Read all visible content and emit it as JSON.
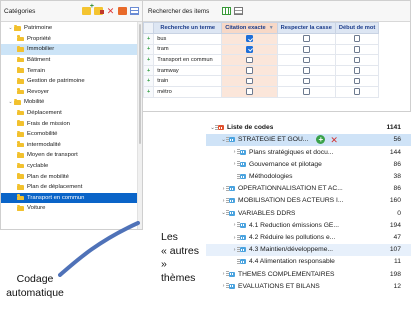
{
  "categories": {
    "title": "Catégories",
    "toolbar_icons": [
      "new-folder-icon",
      "edit-folder-icon",
      "delete-icon",
      "export-icon",
      "table-icon"
    ],
    "items": [
      {
        "label": "Patrimoine",
        "level": 0,
        "expanded": true
      },
      {
        "label": "Propriété",
        "level": 1
      },
      {
        "label": "Immobilier",
        "level": 1,
        "selected": true
      },
      {
        "label": "Bâtiment",
        "level": 1
      },
      {
        "label": "Terrain",
        "level": 1
      },
      {
        "label": "Gestion de patrimoine",
        "level": 1
      },
      {
        "label": "Revoyer",
        "level": 1
      },
      {
        "label": "Mobilité",
        "level": 0,
        "expanded": true
      },
      {
        "label": "Déplacement",
        "level": 1
      },
      {
        "label": "Frais de mission",
        "level": 1
      },
      {
        "label": "Ecomobilité",
        "level": 1
      },
      {
        "label": "intermodalité",
        "level": 1
      },
      {
        "label": "Moyen de transport",
        "level": 1
      },
      {
        "label": "cyclable",
        "level": 1
      },
      {
        "label": "Plan de mobilité",
        "level": 1
      },
      {
        "label": "Plan de déplacement",
        "level": 1
      },
      {
        "label": "Transport en commun",
        "level": 1,
        "active": true
      },
      {
        "label": "Voiture",
        "level": 1
      }
    ]
  },
  "search": {
    "title": "Rechercher des items",
    "columns": [
      "Recherche un terme",
      "Citation exacte",
      "Respecter la casse",
      "Début de mot"
    ],
    "rows": [
      {
        "term": "bus",
        "exact": true,
        "case": false,
        "start": false
      },
      {
        "term": "tram",
        "exact": true,
        "case": false,
        "start": false
      },
      {
        "term": "Transport en commun",
        "exact": false,
        "case": false,
        "start": false
      },
      {
        "term": "tramway",
        "exact": false,
        "case": false,
        "start": false
      },
      {
        "term": "train",
        "exact": false,
        "case": false,
        "start": false
      },
      {
        "term": "métro",
        "exact": false,
        "case": false,
        "start": false
      }
    ]
  },
  "codes": {
    "items": [
      {
        "label": "Liste de codes",
        "count": "1141",
        "level": 0,
        "chev": "⌄",
        "icon": "red",
        "top": true
      },
      {
        "label": "STRATEGIE ET GOU...",
        "count": "56",
        "level": 1,
        "chev": "⌄",
        "icon": "blue",
        "hl": "hl",
        "actions": true
      },
      {
        "label": "Plans stratégiques et docu...",
        "count": "144",
        "level": 2,
        "chev": "›",
        "icon": "blue"
      },
      {
        "label": "Gouvernance et pilotage",
        "count": "86",
        "level": 2,
        "chev": "›",
        "icon": "blue"
      },
      {
        "label": "Méthodologies",
        "count": "38",
        "level": 2,
        "chev": "",
        "icon": "blue"
      },
      {
        "label": "OPERATIONNALISATION ET AC...",
        "count": "86",
        "level": 1,
        "chev": "›",
        "icon": "blue"
      },
      {
        "label": "MOBILISATION DES ACTEURS I...",
        "count": "160",
        "level": 1,
        "chev": "›",
        "icon": "blue"
      },
      {
        "label": "VARIABLES DDRS",
        "count": "0",
        "level": 1,
        "chev": "⌄",
        "icon": "blue"
      },
      {
        "label": "4.1 Reduction émissions GE...",
        "count": "194",
        "level": 2,
        "chev": "›",
        "icon": "blue"
      },
      {
        "label": "4.2 Réduire les pollutions e...",
        "count": "47",
        "level": 2,
        "chev": "›",
        "icon": "blue"
      },
      {
        "label": "4.3 Maintien/développeme...",
        "count": "107",
        "level": 2,
        "chev": "›",
        "icon": "blue",
        "hl": "hl2"
      },
      {
        "label": "4.4 Alimentation responsable",
        "count": "11",
        "level": 2,
        "chev": "",
        "icon": "blue"
      },
      {
        "label": "THEMES COMPLEMENTAIRES",
        "count": "198",
        "level": 1,
        "chev": "›",
        "icon": "blue"
      },
      {
        "label": "EVALUATIONS ET BILANS",
        "count": "12",
        "level": 1,
        "chev": "›",
        "icon": "blue"
      }
    ]
  },
  "annotations": {
    "autres_line1": "Les",
    "autres_line2": "« autres »",
    "autres_line3": "thèmes",
    "codage_line1": "Codage",
    "codage_line2": "automatique"
  },
  "colors": {
    "selection": "#0a64c8",
    "selection_light": "#cce4f7",
    "exact_column": "#fbe6da",
    "folder": "#f2c12e",
    "add": "#3aa24a",
    "delete": "#d23030",
    "arrow": "#4f72b8"
  }
}
